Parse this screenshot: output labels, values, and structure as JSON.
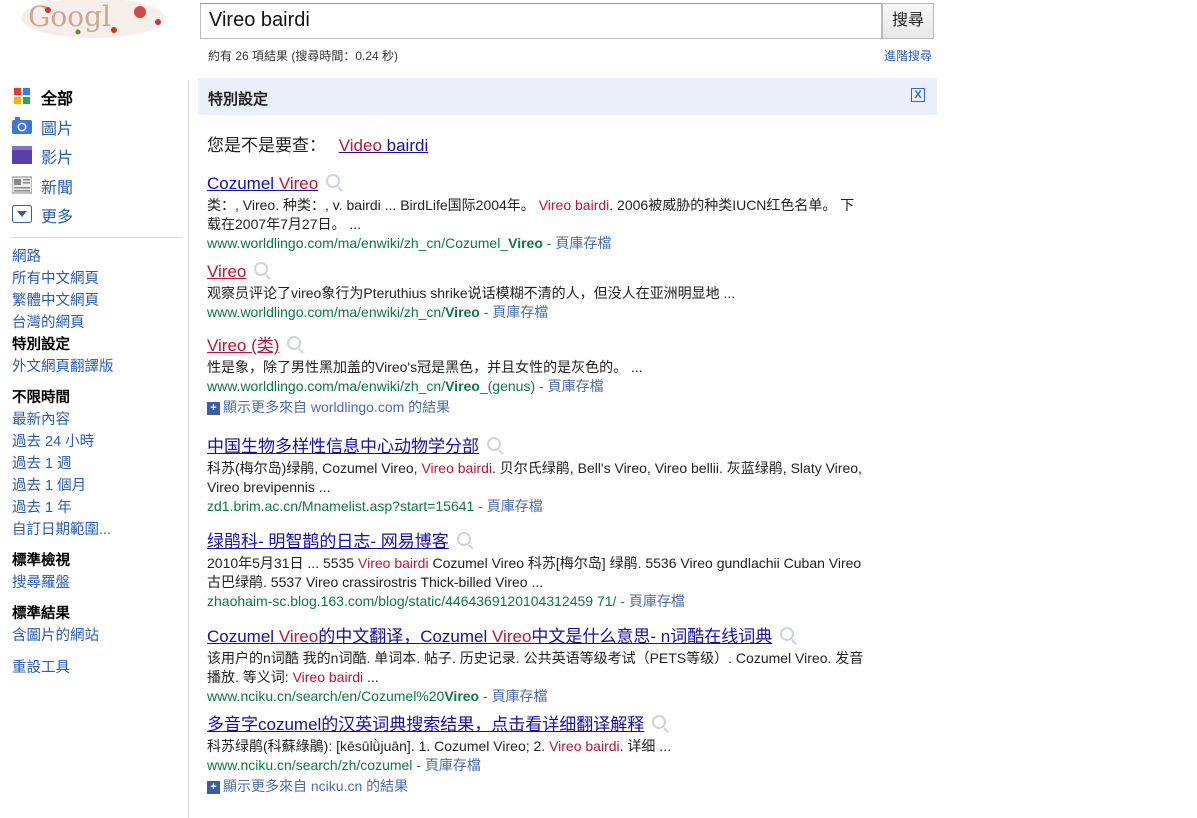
{
  "logo_text": "Google",
  "search": {
    "query": "Vireo bairdi",
    "button": "搜尋"
  },
  "result_stats": "約有 26 項結果 (搜尋時間：0.24 秒)",
  "advanced_link": "進階搜尋",
  "left_nav": {
    "types": [
      {
        "label": "全部",
        "icon": "google-grid-icon",
        "selected": true
      },
      {
        "label": "圖片",
        "icon": "camera-icon",
        "selected": false
      },
      {
        "label": "影片",
        "icon": "video-icon",
        "selected": false
      },
      {
        "label": "新聞",
        "icon": "newspaper-icon",
        "selected": false
      },
      {
        "label": "更多",
        "icon": "chevron-down-icon",
        "selected": false
      }
    ],
    "scope": [
      "網路",
      "所有中文網頁",
      "繁體中文網頁",
      "台灣的網頁",
      "特別設定",
      "外文網頁翻譯版"
    ],
    "time_header": "不限時間",
    "time": [
      "最新內容",
      "過去 24 小時",
      "過去 1 週",
      "過去 1 個月",
      "過去 1 年",
      "自訂日期範圍..."
    ],
    "view_header": "標準檢視",
    "view": [
      "搜尋羅盤"
    ],
    "result_header": "標準結果",
    "result": [
      "含圖片的網站"
    ],
    "reset": "重設工具"
  },
  "custom_bar": {
    "label": "特別設定",
    "close": "X"
  },
  "did_you_mean": {
    "prefix": "您是不是要查：",
    "em": "Video",
    "rest": " bairdi"
  },
  "results": [
    {
      "t1": "Cozumel ",
      "t2": "Vireo",
      "t3": "",
      "s1": "类：, Vireo. 种类：, v. bairdi ... BirdLife国际2004年。 ",
      "sk": "Vireo bairdi",
      "s2": ". 2006被威胁的种类IUCN红色名单。 下载在2007年7月27日。 ...",
      "u1": "www.worldlingo.com/ma/enwiki/zh_cn/Cozumel_",
      "ub": "Vireo",
      "u2": "",
      "cache": "頁庫存檔"
    },
    {
      "t1": "",
      "t2": "Vireo",
      "t3": "",
      "s1": "观察员评论了vireo象行为Pteruthius shrike说话模糊不清的人，但没人在亚洲明显地 ...",
      "sk": "",
      "s2": "",
      "u1": "www.worldlingo.com/ma/enwiki/zh_cn/",
      "ub": "Vireo",
      "u2": "",
      "cache": "頁庫存檔"
    },
    {
      "t1": "",
      "t2": "Vireo (类)",
      "t3": "",
      "s1": "性是象，除了男性黑加盖的Vireo's冠是黑色，并且女性的是灰色的。 ...",
      "sk": "",
      "s2": "",
      "u1": "www.worldlingo.com/ma/enwiki/zh_cn/",
      "ub": "Vireo",
      "u2": "_(genus)",
      "cache": "頁庫存檔"
    },
    {
      "t1": "中国生物多样性信息中心动物学分部",
      "t2": "",
      "t3": "",
      "s1": "科苏(梅尔岛)绿鹃, Cozumel Vireo, ",
      "sk": "Vireo bairdi",
      "s2": ". 贝尔氏绿鹃, Bell's Vireo, Vireo bellii. 灰蓝绿鹃, Slaty Vireo, Vireo brevipennis ...",
      "u1": "zd1.brim.ac.cn/Mnamelist.asp?start=15641",
      "ub": "",
      "u2": "",
      "cache": "頁庫存檔"
    },
    {
      "t1": "绿鹃科- 明智鹊的日志- 网易博客",
      "t2": "",
      "t3": "",
      "s1": "2010年5月31日 ... 5535 ",
      "sk": "Vireo bairdi",
      "s2": " Cozumel Vireo 科苏[梅尔岛] 绿鹃. 5536 Vireo gundlachii Cuban Vireo 古巴绿鹃. 5537 Vireo crassirostris Thick-billed Vireo ...",
      "u1": "zhaohaim-sc.blog.163.com/blog/static/4464369120104312459 71/",
      "ub": "",
      "u2": "",
      "cache": "頁庫存檔"
    },
    {
      "t1": "Cozumel ",
      "t2": "Vireo",
      "t3": "的中文翻译，Cozumel ",
      "t4": "Vireo",
      "t5": "中文是什么意思- n词酷在线词典",
      "s1": "该用户的n词酷 我的n词酷. 单词本. 帖子. 历史记录. 公共英语等级考试（PETS等级）. Cozumel Vireo. 发音播放. 等义词: ",
      "sk": "Vireo bairdi",
      "s2": " ...",
      "u1": "www.nciku.cn/search/en/Cozumel%20",
      "ub": "Vireo",
      "u2": "",
      "cache": "頁庫存檔"
    },
    {
      "t1": "多音字cozumel的汉英词典搜索结果，点击看详细翻译解释",
      "t2": "",
      "t3": "",
      "s1": "科苏绿鹃(科蘇綠鵑): [kēsūlǜjuān]. 1. Cozumel Vireo; 2. ",
      "sk": "Vireo bairdi",
      "s2": ". 详细 ...",
      "u1": "www.nciku.cn/search/zh/cozumel",
      "ub": "",
      "u2": "",
      "cache": "頁庫存檔"
    }
  ],
  "more_links": [
    "顯示更多來自 worldlingo.com 的結果",
    "顯示更多來自 nciku.cn 的結果"
  ],
  "colors": {
    "link": "#1a0dab",
    "keyword": "#c0143c",
    "url": "#0e774a",
    "bar": "#ebeff9"
  }
}
